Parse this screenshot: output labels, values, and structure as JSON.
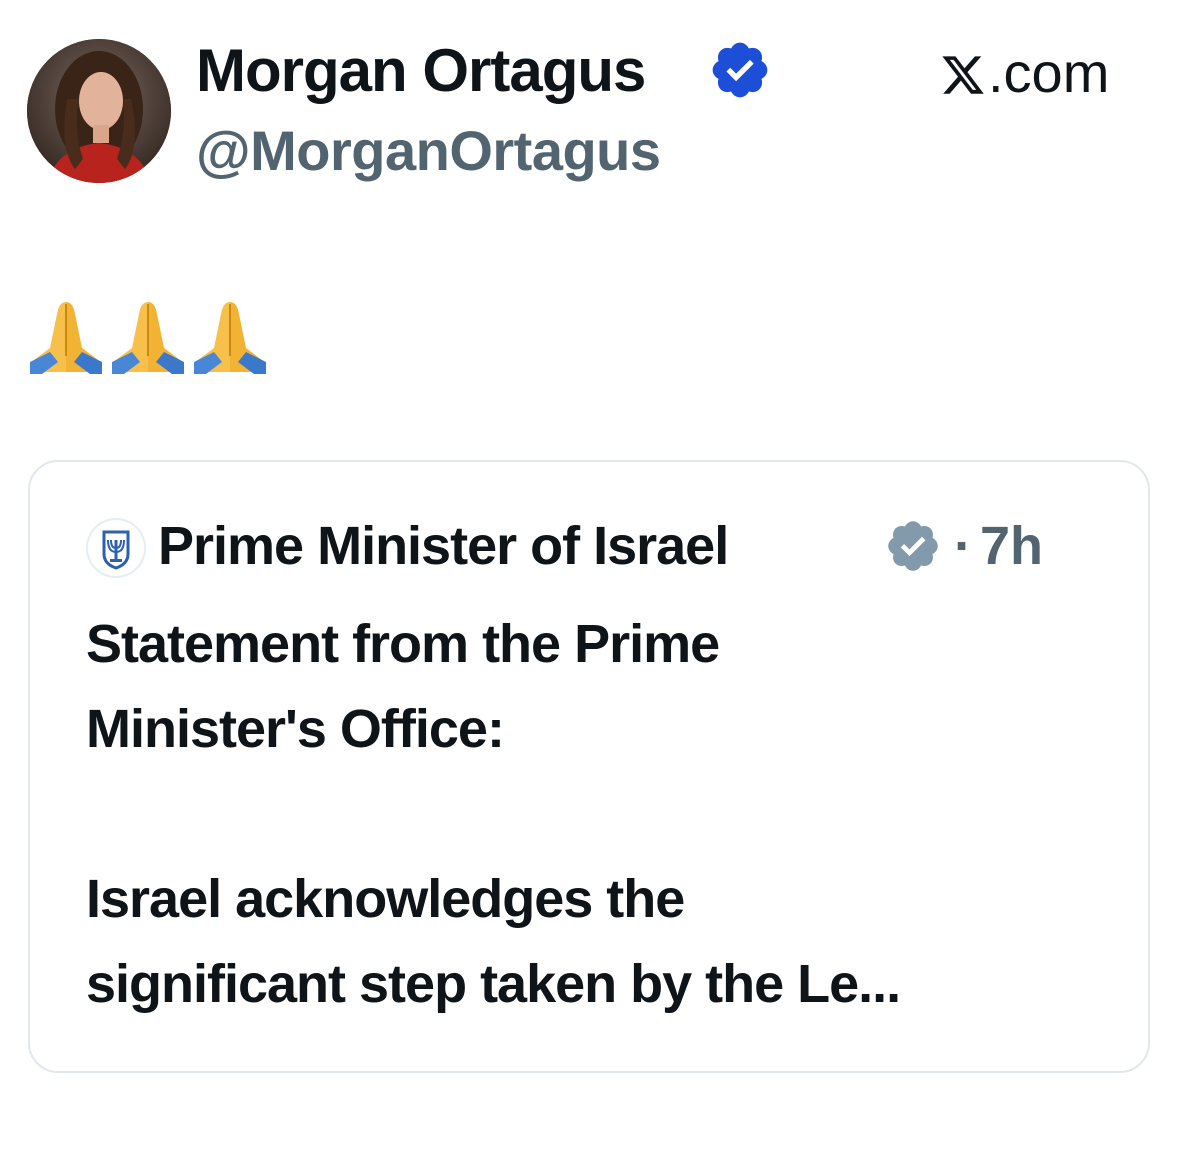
{
  "author": {
    "name": "Morgan Ortagus",
    "handle": "@MorganOrtagus",
    "verified": true,
    "badge_color": "#1d4ed8"
  },
  "brand": {
    "label": ".com",
    "icon": "x-logo-icon"
  },
  "tweet": {
    "emojis": [
      "🙏",
      "🙏",
      "🙏"
    ]
  },
  "quoted_tweet": {
    "author": "Prime Minister of Israel",
    "verified": true,
    "badge_color": "#829aab",
    "separator": "·",
    "time": "7h",
    "text_lines": [
      "Statement from the Prime",
      "Minister's Office:",
      "",
      "Israel acknowledges the",
      "significant step taken by the Le..."
    ]
  }
}
